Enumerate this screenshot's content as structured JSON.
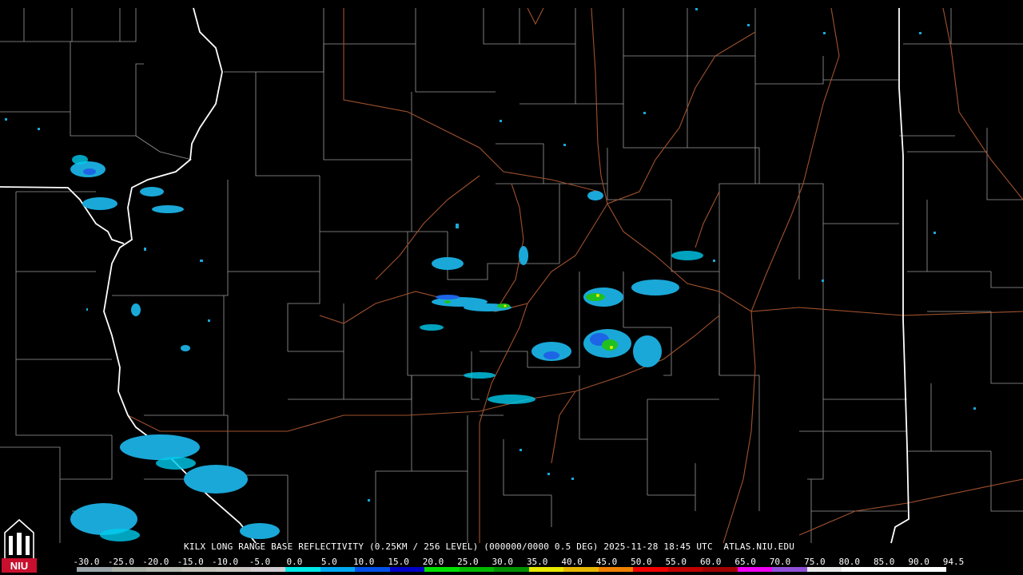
{
  "caption": "KILX LONG RANGE BASE REFLECTIVITY (0.25KM / 256 LEVEL) (000000/0000 0.5 DEG) 2025-11-28 18:45 UTC  ATLAS.NIU.EDU",
  "logo_text": "NIU",
  "scale": {
    "labels": [
      "-30.0",
      "-25.0",
      "-20.0",
      "-15.0",
      "-10.0",
      "-5.0",
      "0.0",
      "5.0",
      "10.0",
      "15.0",
      "20.0",
      "25.0",
      "30.0",
      "35.0",
      "40.0",
      "45.0",
      "50.0",
      "55.0",
      "60.0",
      "65.0",
      "70.0",
      "75.0",
      "80.0",
      "85.0",
      "90.0",
      "94.5"
    ],
    "colors": [
      "#9aa4a8",
      "#a8b0a8",
      "#b4b8b0",
      "#c0c0b8",
      "#c8c4c0",
      "#d0ccd0",
      "#00e8e8",
      "#00a8f0",
      "#0050e8",
      "#0000c8",
      "#00e000",
      "#00b800",
      "#009000",
      "#e8e800",
      "#e8b800",
      "#f08000",
      "#f00000",
      "#c00000",
      "#a00000",
      "#f000f0",
      "#9050d8",
      "#e8e8e8",
      "#ffffff",
      "#ffffff",
      "#ffffff"
    ]
  }
}
